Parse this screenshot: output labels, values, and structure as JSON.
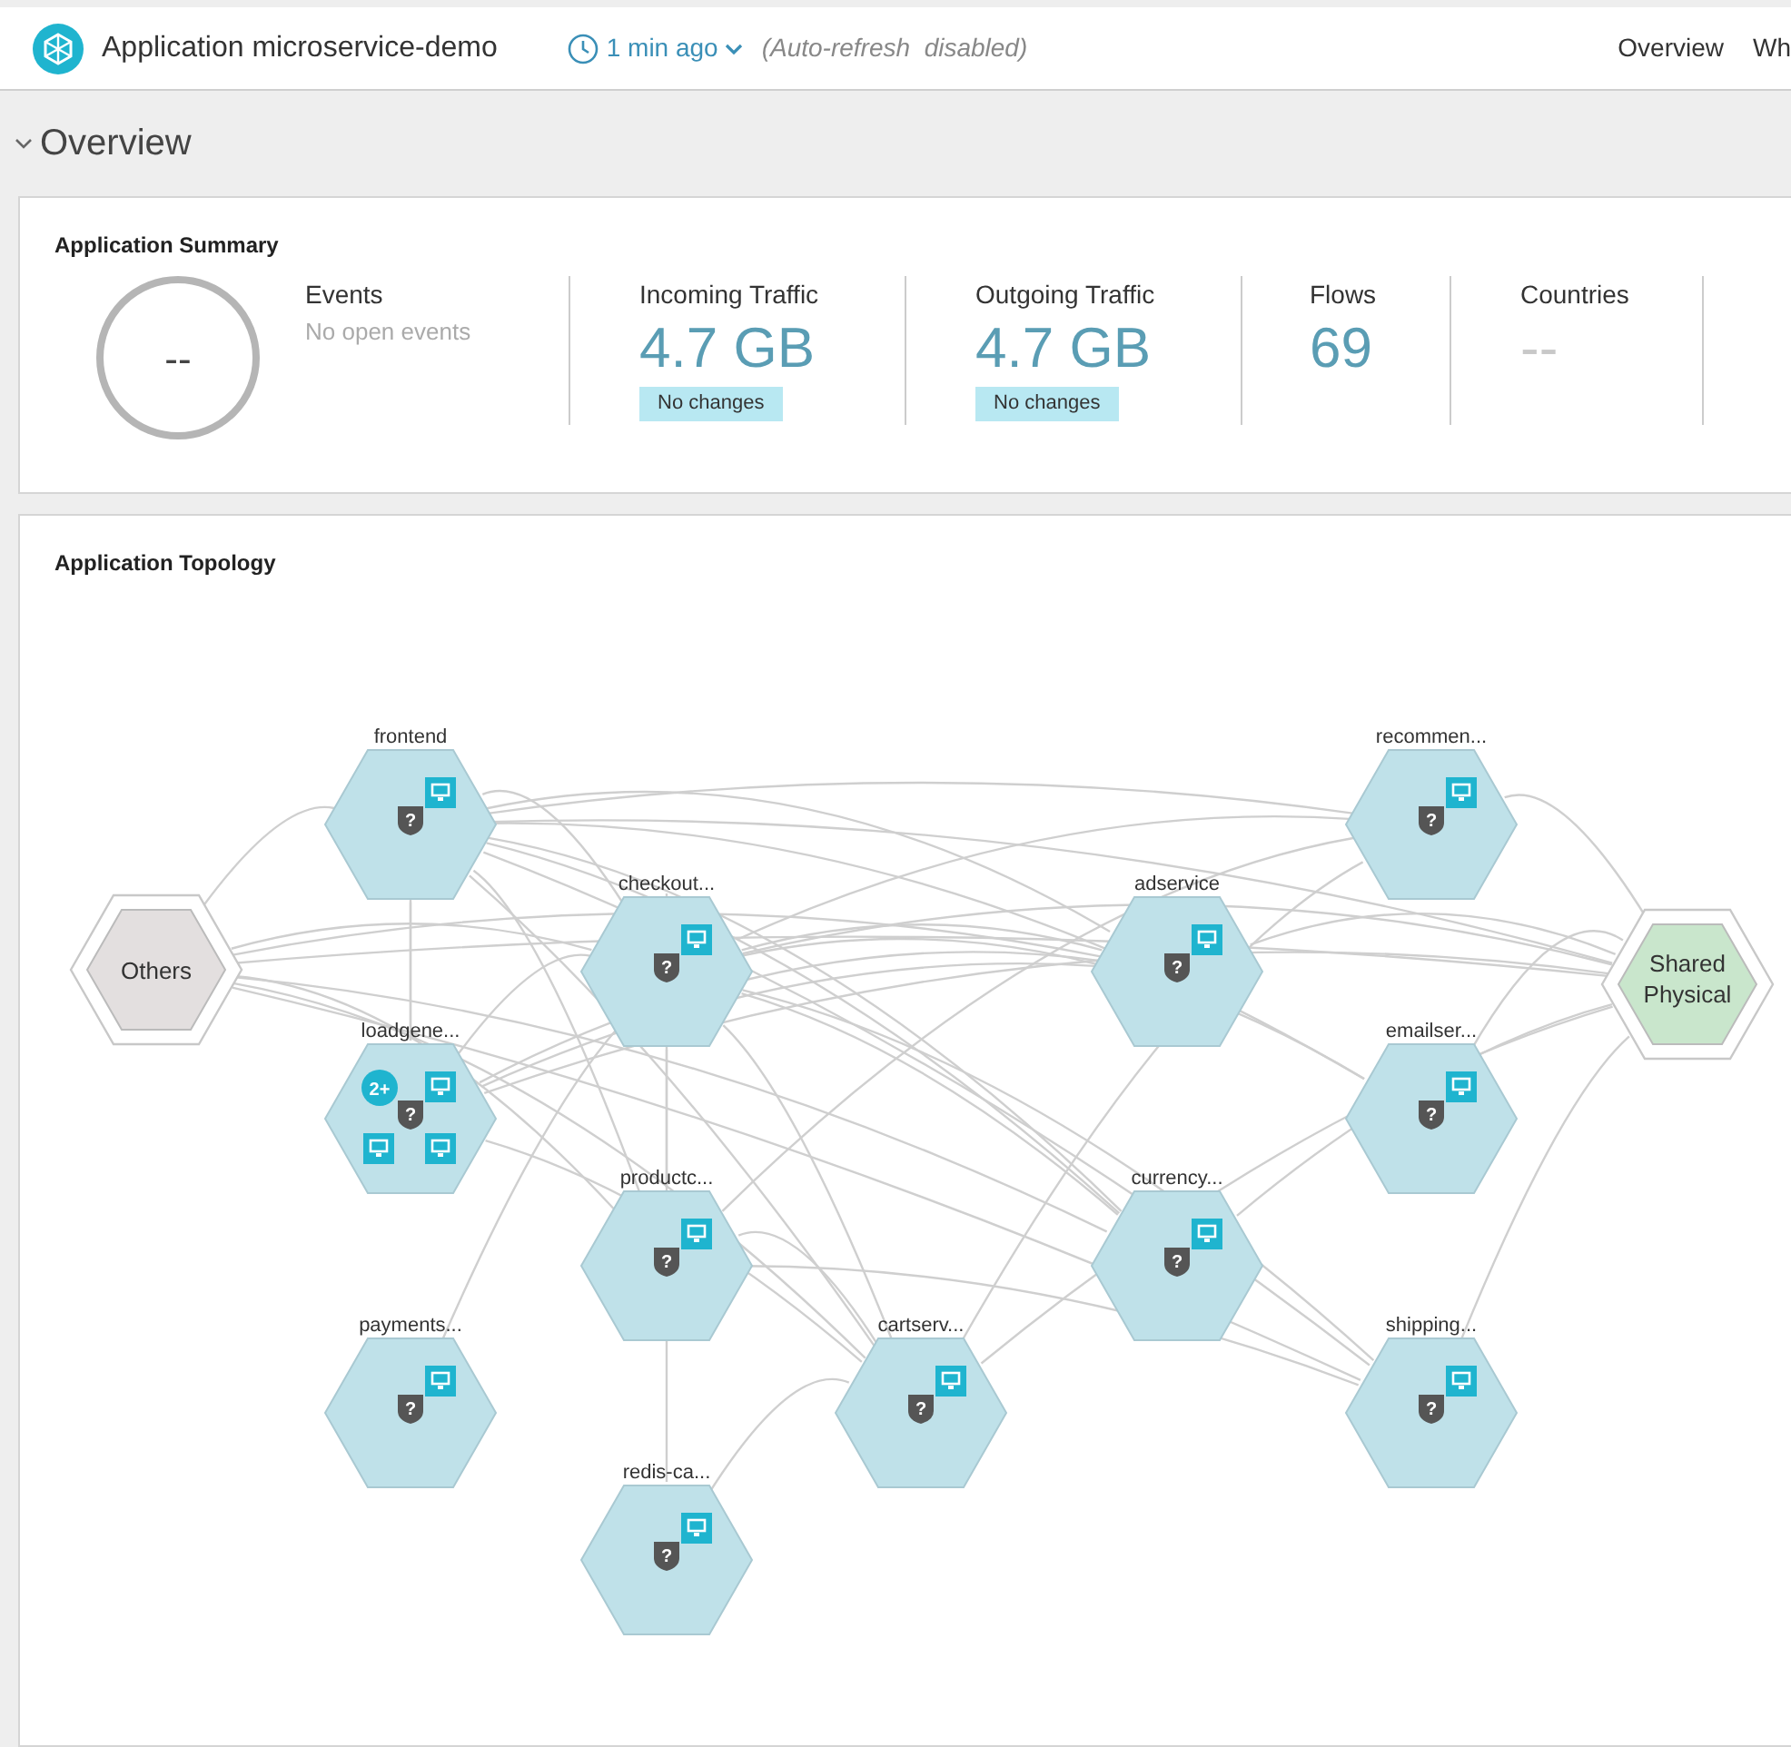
{
  "header": {
    "title": "Application microservice-demo",
    "time": "1 min ago",
    "refresh_note": "(Auto-refresh  disabled)",
    "nav": [
      "Overview",
      "Wh"
    ]
  },
  "section": {
    "title": "Overview",
    "expanded": true
  },
  "summary": {
    "title": "Application Summary",
    "events_count": "--",
    "events_label": "Events",
    "events_note": "No open events",
    "metrics": [
      {
        "label": "Incoming Traffic",
        "value": "4.7 GB",
        "badge": "No changes",
        "muted": false
      },
      {
        "label": "Outgoing Traffic",
        "value": "4.7 GB",
        "badge": "No changes",
        "muted": false
      },
      {
        "label": "Flows",
        "value": "69",
        "muted": false
      },
      {
        "label": "Countries",
        "value": "--",
        "muted": true
      }
    ]
  },
  "topology": {
    "title": "Application Topology",
    "nodes": [
      {
        "name": "Others",
        "kind": "external"
      },
      {
        "name": "frontend",
        "kind": "service",
        "badge": "?"
      },
      {
        "name": "checkout...",
        "kind": "service",
        "badge": "?"
      },
      {
        "name": "adservice",
        "kind": "service",
        "badge": "?"
      },
      {
        "name": "recommen...",
        "kind": "service",
        "badge": "?"
      },
      {
        "name": "Shared Physical",
        "kind": "shared"
      },
      {
        "name": "loadgene...",
        "kind": "cluster",
        "badge": "?",
        "count": "2+"
      },
      {
        "name": "emailser...",
        "kind": "service",
        "badge": "?"
      },
      {
        "name": "productc...",
        "kind": "service",
        "badge": "?"
      },
      {
        "name": "currency...",
        "kind": "service",
        "badge": "?"
      },
      {
        "name": "payments...",
        "kind": "service",
        "badge": "?"
      },
      {
        "name": "cartserv...",
        "kind": "service",
        "badge": "?"
      },
      {
        "name": "shipping...",
        "kind": "service",
        "badge": "?"
      },
      {
        "name": "redis-ca...",
        "kind": "service",
        "badge": "?"
      }
    ]
  }
}
